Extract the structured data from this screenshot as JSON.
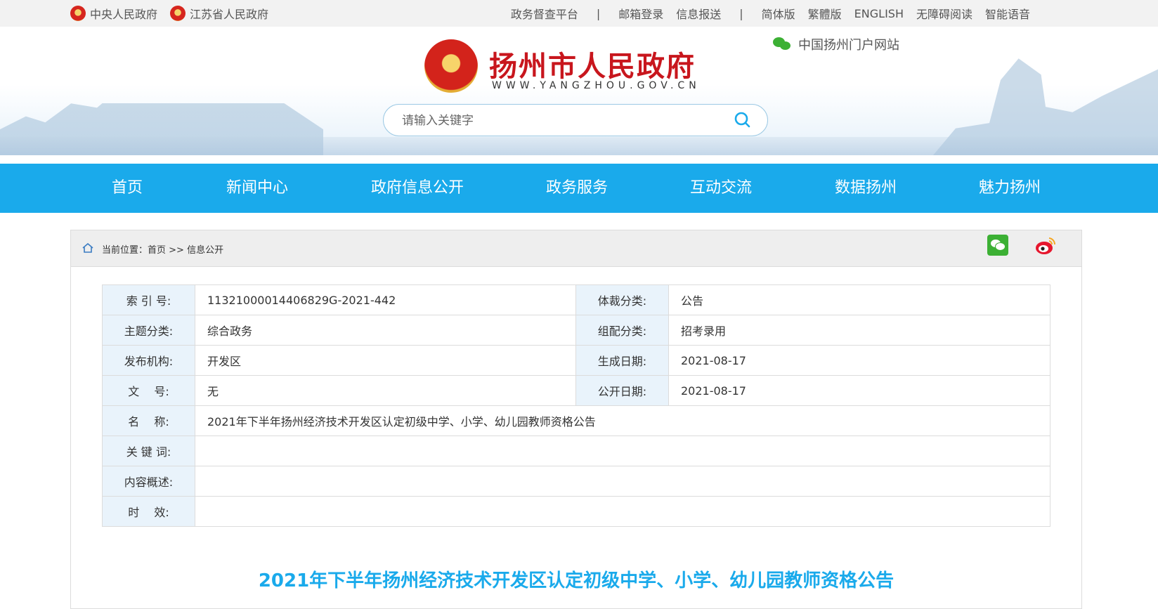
{
  "topbar": {
    "left_links": [
      "中央人民政府",
      "江苏省人民政府"
    ],
    "platform": "政务督查平台",
    "separator": "|",
    "mail": "邮箱登录",
    "report": "信息报送",
    "simplified": "简体版",
    "traditional": "繁體版",
    "english": "ENGLISH",
    "accessible": "无障碍阅读",
    "voice": "智能语音"
  },
  "header": {
    "title": "扬州市人民政府",
    "url": "WWW.YANGZHOU.GOV.CN",
    "portal": "中国扬州门户网站",
    "search_placeholder": "请输入关键字"
  },
  "nav": [
    "首页",
    "新闻中心",
    "政府信息公开",
    "政务服务",
    "互动交流",
    "数据扬州",
    "魅力扬州"
  ],
  "breadcrumb": {
    "label": "当前位置：",
    "home": "首页",
    "sep": " >> ",
    "current": "信息公开"
  },
  "meta": {
    "index_label": "索 引 号:",
    "index": "11321000014406829G-2021-442",
    "genre_label": "体裁分类:",
    "genre": "公告",
    "topic_label": "主题分类:",
    "topic": "综合政务",
    "assign_label": "组配分类:",
    "assign": "招考录用",
    "org_label": "发布机构:",
    "org": "开发区",
    "created_label": "生成日期:",
    "created": "2021-08-17",
    "docno_label": "文　 号:",
    "docno": "无",
    "public_label": "公开日期:",
    "public": "2021-08-17",
    "name_label": "名　 称:",
    "name": "2021年下半年扬州经济技术开发区认定初级中学、小学、幼儿园教师资格公告",
    "keywords_label": "关 键 词:",
    "keywords": "",
    "summary_label": "内容概述:",
    "summary": "",
    "validity_label": "时　 效:",
    "validity": ""
  },
  "doc_title": "2021年下半年扬州经济技术开发区认定初级中学、小学、幼儿园教师资格公告",
  "colors": {
    "nav_blue": "#1aaaeb",
    "title_red": "#c8161d",
    "meta_key_bg": "#e9f3fb"
  }
}
